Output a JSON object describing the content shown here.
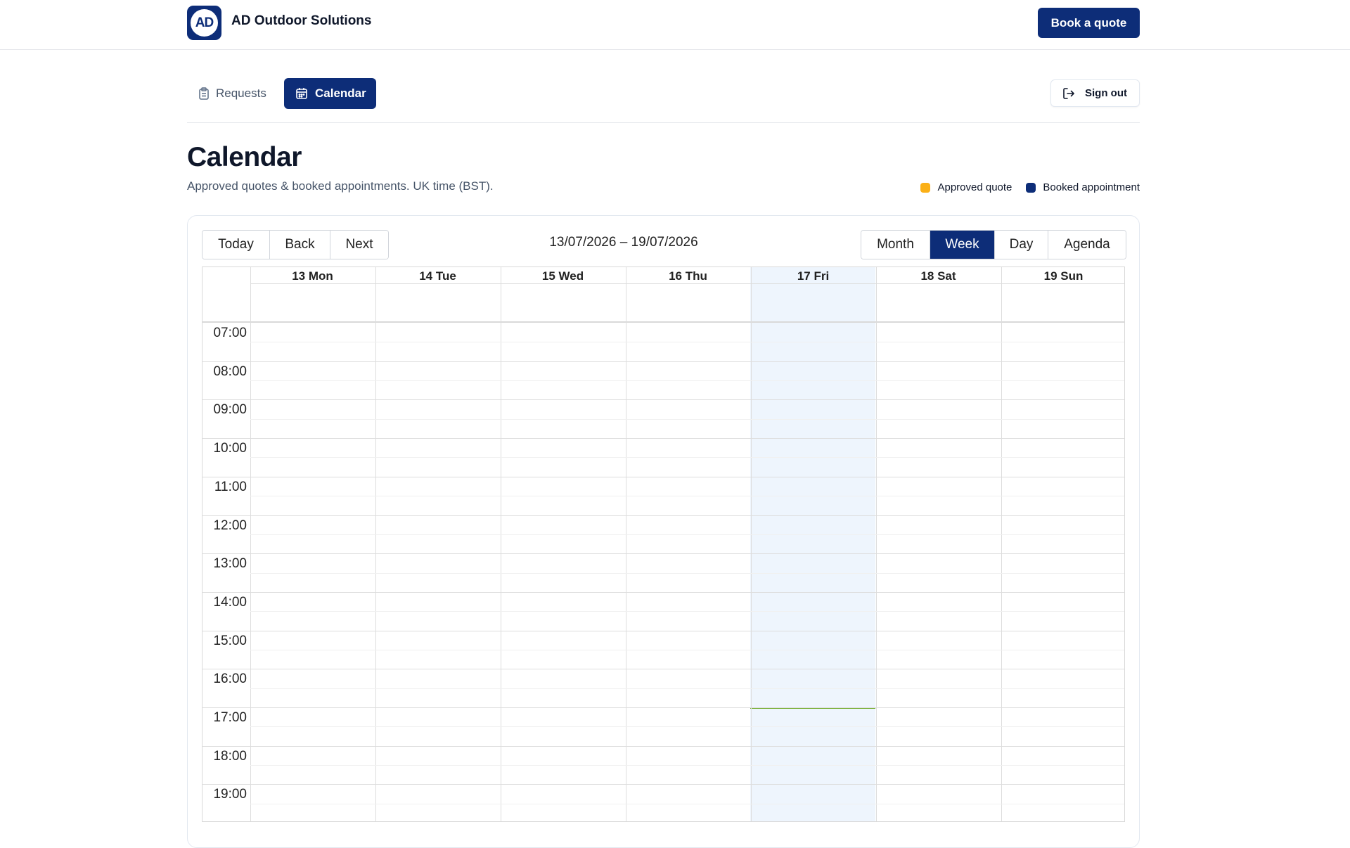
{
  "brand": {
    "logo_text": "AD",
    "name": "AD Outdoor Solutions"
  },
  "header": {
    "book_label": "Book a quote"
  },
  "nav": {
    "requests_label": "Requests",
    "calendar_label": "Calendar",
    "signout_label": "Sign out"
  },
  "page": {
    "title": "Calendar",
    "subtitle": "Approved quotes & booked appointments. UK time (BST)."
  },
  "legend": [
    {
      "label": "Approved quote",
      "color": "#fbb017"
    },
    {
      "label": "Booked appointment",
      "color": "#0d2d78"
    }
  ],
  "toolbar": {
    "nav_buttons": [
      "Today",
      "Back",
      "Next"
    ],
    "range_label": "13/07/2026 – 19/07/2026",
    "views": [
      "Month",
      "Week",
      "Day",
      "Agenda"
    ],
    "active_view": "Week"
  },
  "calendar": {
    "days": [
      "13 Mon",
      "14 Tue",
      "15 Wed",
      "16 Thu",
      "17 Fri",
      "18 Sat",
      "19 Sun"
    ],
    "today_index": 4,
    "hours": [
      "07:00",
      "08:00",
      "09:00",
      "10:00",
      "11:00",
      "12:00",
      "13:00",
      "14:00",
      "15:00",
      "16:00",
      "17:00",
      "18:00",
      "19:00"
    ],
    "now_time": "17:00"
  },
  "colors": {
    "primary": "#0d2d78",
    "today_bg": "#eef5fd",
    "now_line": "#74ad31"
  }
}
